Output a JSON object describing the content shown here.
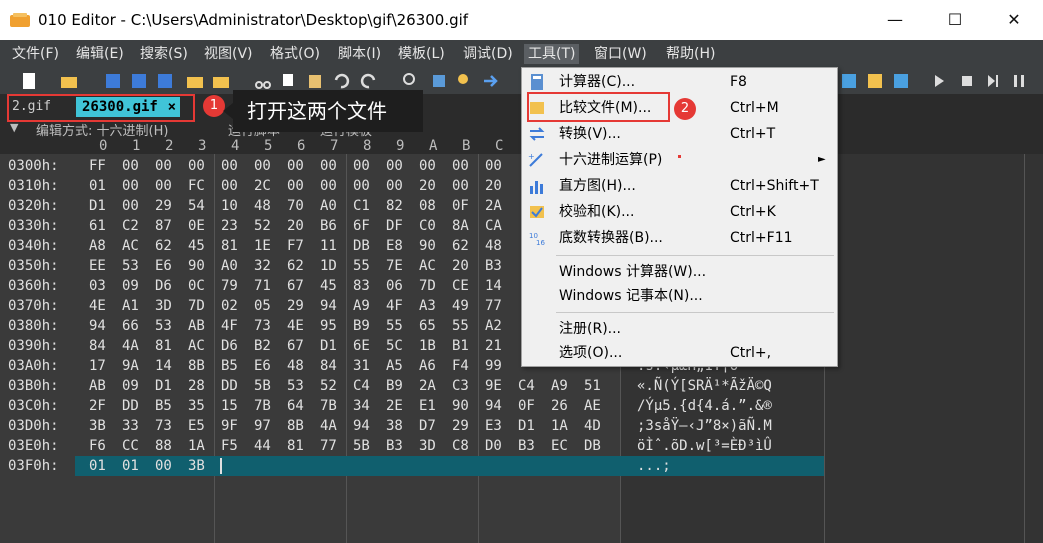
{
  "window": {
    "title": "010 Editor - C:\\Users\\Administrator\\Desktop\\gif\\26300.gif",
    "minimize": "—",
    "maximize": "☐",
    "close": "✕"
  },
  "menubar": [
    "文件(F)",
    "编辑(E)",
    "搜索(S)",
    "视图(V)",
    "格式(O)",
    "脚本(I)",
    "模板(L)",
    "调试(D)",
    "工具(T)",
    "窗口(W)",
    "帮助(H)"
  ],
  "tabs": {
    "file1": "2.gif",
    "file2": "26300.gif",
    "close": "×"
  },
  "annotations": {
    "badge1": "1",
    "badge2": "2",
    "callout": "打开这两个文件"
  },
  "infobar": {
    "edit_mode": "编辑方式: 十六进制(H)",
    "run_script": "运行脚本",
    "run_template": "运行模板"
  },
  "column_header": [
    "0",
    "1",
    "2",
    "3",
    "4",
    "5",
    "6",
    "7",
    "8",
    "9",
    "A",
    "B",
    "C"
  ],
  "rows": [
    {
      "addr": "0300h:",
      "bytes": [
        "FF",
        "00",
        "00",
        "00",
        "00",
        "00",
        "00",
        "00",
        "00",
        "00",
        "00",
        "00",
        "00"
      ],
      "ascii": ""
    },
    {
      "addr": "0310h:",
      "bytes": [
        "01",
        "00",
        "00",
        "FC",
        "00",
        "2C",
        "00",
        "00",
        "00",
        "00",
        "20",
        "00",
        "20"
      ],
      "ascii": ""
    },
    {
      "addr": "0320h:",
      "bytes": [
        "D1",
        "00",
        "29",
        "54",
        "10",
        "48",
        "70",
        "A0",
        "C1",
        "82",
        "08",
        "0F",
        "2A"
      ],
      "ascii": ""
    },
    {
      "addr": "0330h:",
      "bytes": [
        "61",
        "C2",
        "87",
        "0E",
        "23",
        "52",
        "20",
        "B6",
        "6F",
        "DF",
        "C0",
        "8A",
        "CA"
      ],
      "ascii": ""
    },
    {
      "addr": "0340h:",
      "bytes": [
        "A8",
        "AC",
        "62",
        "45",
        "81",
        "1E",
        "F7",
        "11",
        "DB",
        "E8",
        "90",
        "62",
        "48"
      ],
      "ascii": ""
    },
    {
      "addr": "0350h:",
      "bytes": [
        "EE",
        "53",
        "E6",
        "90",
        "A0",
        "32",
        "62",
        "1D",
        "55",
        "7E",
        "AC",
        "20",
        "B3"
      ],
      "ascii": ""
    },
    {
      "addr": "0360h:",
      "bytes": [
        "03",
        "09",
        "D6",
        "0C",
        "79",
        "71",
        "67",
        "45",
        "83",
        "06",
        "7D",
        "CE",
        "14"
      ],
      "ascii": ""
    },
    {
      "addr": "0370h:",
      "bytes": [
        "4E",
        "A1",
        "3D",
        "7D",
        "02",
        "05",
        "29",
        "94",
        "A9",
        "4F",
        "A3",
        "49",
        "77"
      ],
      "ascii": ""
    },
    {
      "addr": "0380h:",
      "bytes": [
        "94",
        "66",
        "53",
        "AB",
        "4F",
        "73",
        "4E",
        "95",
        "B9",
        "55",
        "65",
        "55",
        "A2"
      ],
      "ascii": ""
    },
    {
      "addr": "0390h:",
      "bytes": [
        "84",
        "4A",
        "81",
        "AC",
        "D6",
        "B2",
        "67",
        "D1",
        "6E",
        "5C",
        "1B",
        "B1",
        "21"
      ],
      "ascii": ""
    },
    {
      "addr": "03A0h:",
      "bytes": [
        "17",
        "9A",
        "14",
        "8B",
        "B5",
        "E6",
        "48",
        "84",
        "31",
        "A5",
        "A6",
        "F4",
        "99"
      ],
      "ascii": ".š.‹µæH„1¥¦ô™"
    },
    {
      "addr": "03B0h:",
      "bytes": [
        "AB",
        "09",
        "D1",
        "28",
        "DD",
        "5B",
        "53",
        "52",
        "C4",
        "B9",
        "2A",
        "C3",
        "9E",
        "C4",
        "A9",
        "51"
      ],
      "ascii": "«.Ñ(Ý[SRÄ¹*ÃžÄ©Q"
    },
    {
      "addr": "03C0h:",
      "bytes": [
        "2F",
        "DD",
        "B5",
        "35",
        "15",
        "7B",
        "64",
        "7B",
        "34",
        "2E",
        "E1",
        "90",
        "94",
        "0F",
        "26",
        "AE"
      ],
      "ascii": "/Ýµ5.{d{4.á.”.&®"
    },
    {
      "addr": "03D0h:",
      "bytes": [
        "3B",
        "33",
        "73",
        "E5",
        "9F",
        "97",
        "8B",
        "4A",
        "94",
        "38",
        "D7",
        "29",
        "E3",
        "D1",
        "1A",
        "4D"
      ],
      "ascii": ";3såŸ—‹J”8×)ãÑ.M"
    },
    {
      "addr": "03E0h:",
      "bytes": [
        "F6",
        "CC",
        "88",
        "1A",
        "F5",
        "44",
        "81",
        "77",
        "5B",
        "B3",
        "3D",
        "C8",
        "D0",
        "B3",
        "EC",
        "DB"
      ],
      "ascii": "öÌˆ.õD.w[³=ÈÐ³ìÛ"
    },
    {
      "addr": "03F0h:",
      "bytes": [
        "01",
        "01",
        "00",
        "3B"
      ],
      "ascii": "...;"
    }
  ],
  "tools_menu": [
    {
      "label": "计算器(C)...",
      "shortcut": "F8"
    },
    {
      "label": "比较文件(M)...",
      "shortcut": "Ctrl+M"
    },
    {
      "label": "转换(V)...",
      "shortcut": "Ctrl+T"
    },
    {
      "label": "十六进制运算(P)",
      "shortcut": "",
      "arrow": "►"
    },
    {
      "label": "直方图(H)...",
      "shortcut": "Ctrl+Shift+T"
    },
    {
      "label": "校验和(K)...",
      "shortcut": "Ctrl+K"
    },
    {
      "label": "底数转换器(B)...",
      "shortcut": "Ctrl+F11"
    },
    {
      "label": "Windows 计算器(W)...",
      "shortcut": ""
    },
    {
      "label": "Windows 记事本(N)...",
      "shortcut": ""
    },
    {
      "label": "注册(R)...",
      "shortcut": ""
    },
    {
      "label": "选项(O)...",
      "shortcut": "Ctrl+,"
    }
  ],
  "colors": {
    "accent_tab": "#40c4d8",
    "highlight_row": "#105f6e",
    "annotation_red": "#e53935"
  }
}
